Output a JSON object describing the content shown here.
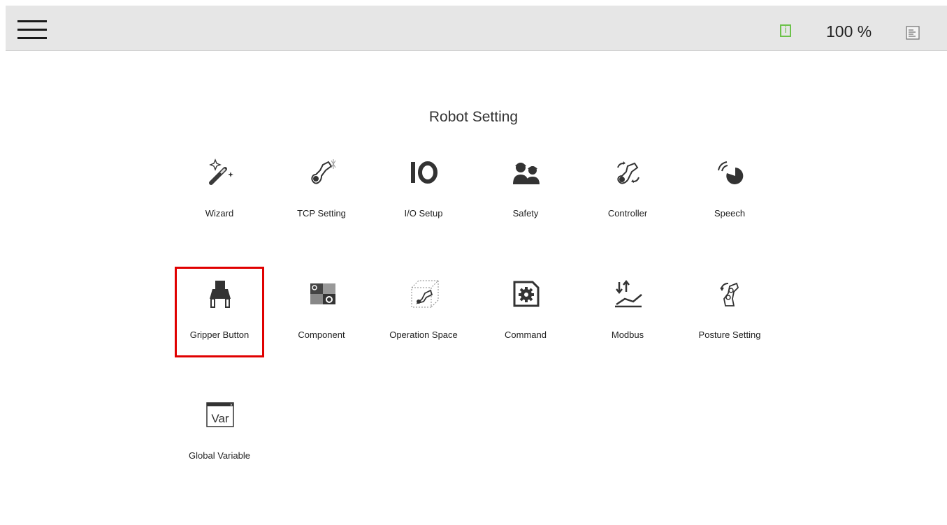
{
  "topbar": {
    "speed_label": "100 %",
    "info_glyph": "i"
  },
  "page": {
    "title": "Robot Setting"
  },
  "items": [
    {
      "label": "Wizard",
      "icon": "magic-wand-icon"
    },
    {
      "label": "TCP Setting",
      "icon": "tcp-tool-icon"
    },
    {
      "label": "I/O Setup",
      "icon": "io-icon"
    },
    {
      "label": "Safety",
      "icon": "safety-workers-icon"
    },
    {
      "label": "Controller",
      "icon": "controller-robot-icon"
    },
    {
      "label": "Speech",
      "icon": "speech-icon"
    },
    {
      "label": "Gripper Button",
      "icon": "gripper-icon",
      "selected": true
    },
    {
      "label": "Component",
      "icon": "component-icon"
    },
    {
      "label": "Operation Space",
      "icon": "operation-space-icon"
    },
    {
      "label": "Command",
      "icon": "command-gear-icon"
    },
    {
      "label": "Modbus",
      "icon": "modbus-icon"
    },
    {
      "label": "Posture Setting",
      "icon": "posture-robot-icon"
    },
    {
      "label": "Global Variable",
      "icon": "global-variable-icon",
      "icon_text": "Var"
    }
  ],
  "colors": {
    "highlight": "#e00000",
    "info_green": "#6cc24a",
    "topbar": "#e6e6e6"
  }
}
